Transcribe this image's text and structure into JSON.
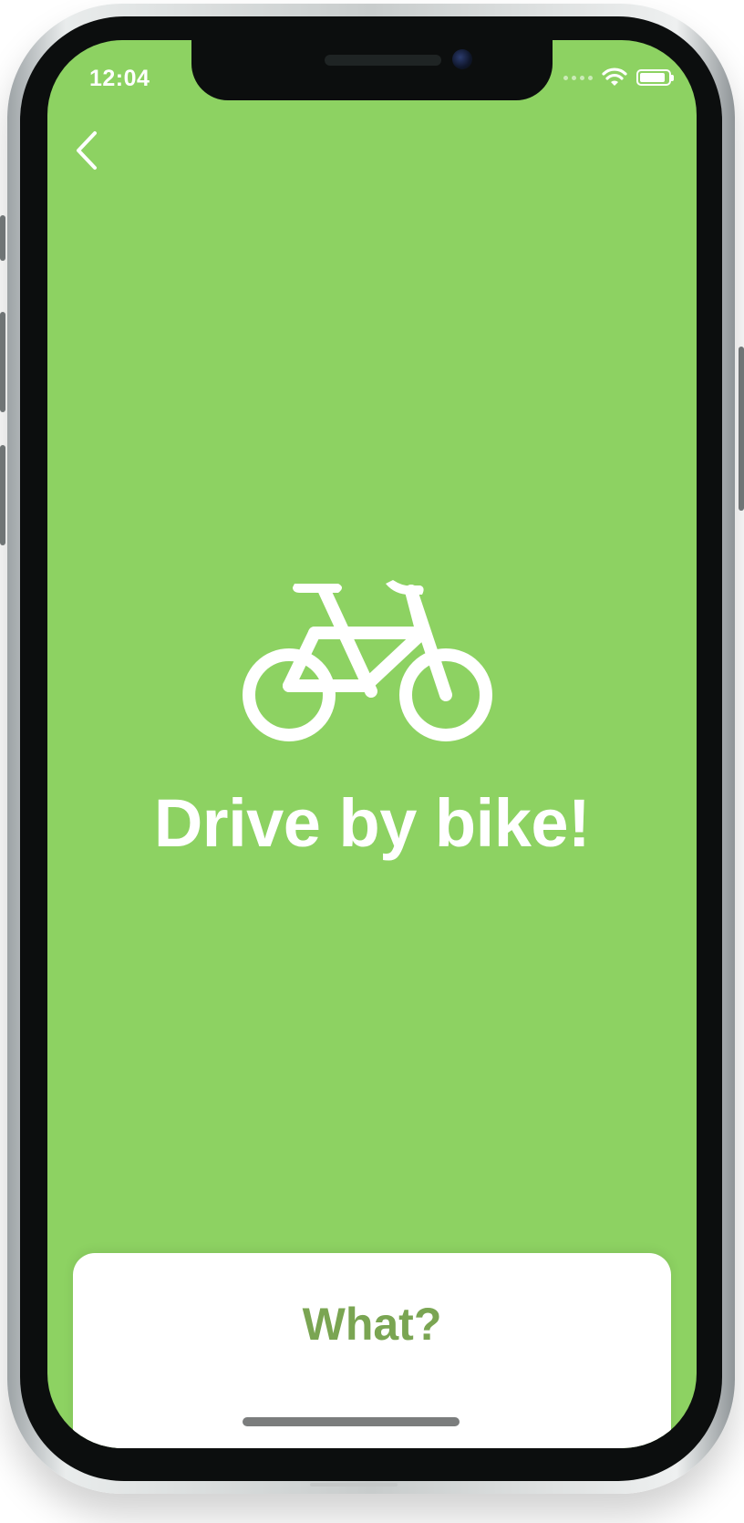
{
  "status_bar": {
    "time": "12:04",
    "wifi_icon": "wifi-icon",
    "battery_icon": "battery-icon",
    "battery_level": 0.9
  },
  "nav": {
    "back_icon": "chevron-left-icon"
  },
  "hero": {
    "icon": "bicycle-icon",
    "title": "Drive by bike!"
  },
  "action": {
    "button_label": "What?"
  },
  "colors": {
    "screen_background": "#8dd262",
    "hero_text": "#ffffff",
    "button_text": "#7aa552",
    "card_background": "#ffffff"
  }
}
